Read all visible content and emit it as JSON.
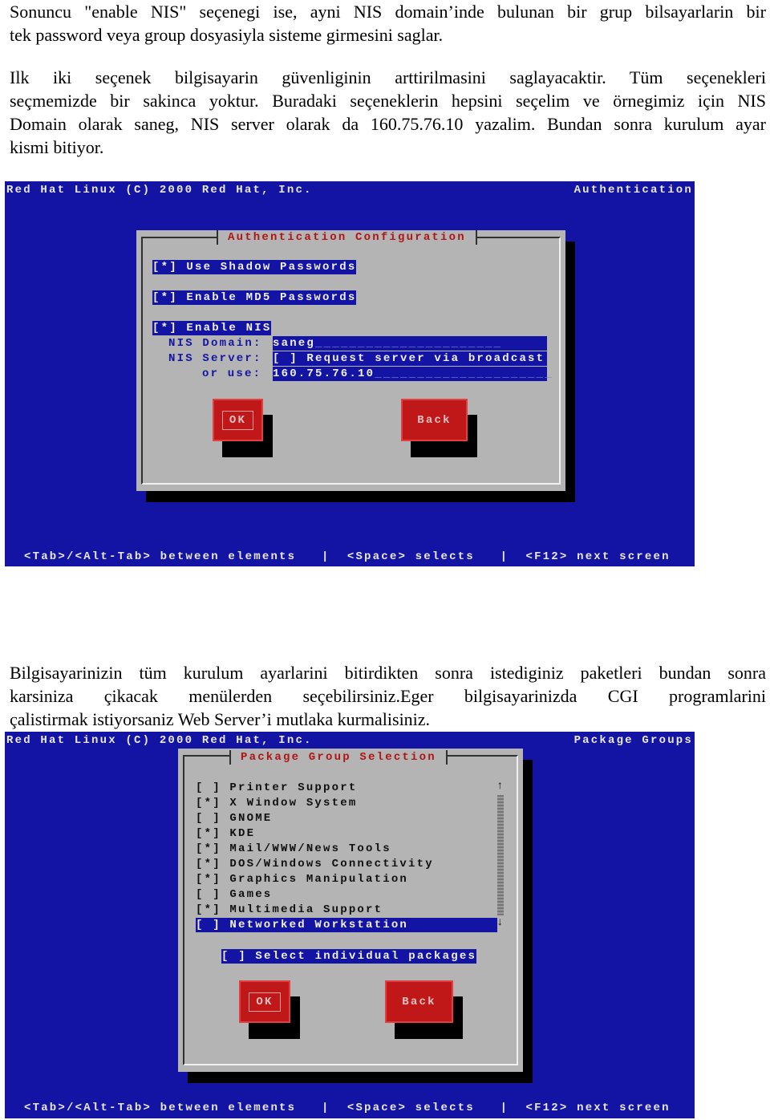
{
  "paragraphs": [
    [
      "Sonuncu \"enable NIS\" seçenegi ise, ayni NIS domain’inde bulunan bir grup bilsayarlarin bir",
      "tek password veya group dosyasiyla sisteme girmesini saglar."
    ],
    [
      "Ilk iki seçenek bilgisayarin güvenliginin arttirilmasini saglayacaktir. Tüm seçenekleri",
      "seçmemizde bir sakinca yoktur. Buradaki seçeneklerin hepsini seçelim ve örnegimiz için NIS",
      "Domain olarak saneg, NIS server olarak da 160.75.76.10 yazalim. Bundan sonra kurulum ayar",
      "kismi bitiyor."
    ],
    [
      "Bilgisayarinizin tüm kurulum ayarlarini bitirdikten sonra istediginiz paketleri bundan sonra",
      "karsiniza çikacak menülerden seçebilirsiniz.Eger bilgisayarinizda CGI programlarini",
      "çalistirmak istiyorsaniz Web Server’i mutlaka kurmalisiniz."
    ]
  ],
  "screen1": {
    "header_left": "Red Hat Linux (C) 2000 Red Hat, Inc.",
    "header_right": "Authentication",
    "dialog_title": "Authentication Configuration",
    "options": [
      "[*] Use Shadow Passwords",
      "[*] Enable MD5 Passwords",
      "[*] Enable NIS"
    ],
    "nis_domain_label": "NIS Domain:",
    "nis_domain_value": "saneg",
    "nis_server_label": "NIS Server:",
    "broadcast_option": "[ ] Request server via broadcast",
    "or_use_label": "or use:",
    "server_value": "160.75.76.10",
    "ok_label": "OK",
    "back_label": "Back",
    "footer": "<Tab>/<Alt-Tab> between elements   |  <Space> selects   |  <F12> next screen"
  },
  "screen2": {
    "header_left": "Red Hat Linux (C) 2000 Red Hat, Inc.",
    "header_right": "Package Groups",
    "dialog_title": "Package Group Selection",
    "packages": [
      {
        "check": "[ ]",
        "name": "Printer Support"
      },
      {
        "check": "[*]",
        "name": "X Window System"
      },
      {
        "check": "[ ]",
        "name": "GNOME"
      },
      {
        "check": "[*]",
        "name": "KDE"
      },
      {
        "check": "[*]",
        "name": "Mail/WWW/News Tools"
      },
      {
        "check": "[*]",
        "name": "DOS/Windows Connectivity"
      },
      {
        "check": "[*]",
        "name": "Graphics Manipulation"
      },
      {
        "check": "[ ]",
        "name": "Games"
      },
      {
        "check": "[*]",
        "name": "Multimedia Support"
      },
      {
        "check": "[ ]",
        "name": "Networked Workstation"
      }
    ],
    "selected_index": 9,
    "individual_option": "[ ] Select individual packages",
    "ok_label": "OK",
    "back_label": "Back",
    "footer": "<Tab>/<Alt-Tab> between elements   |  <Space> selects   |  <F12> next screen"
  },
  "colors": {
    "screen_bg": "#1414a4",
    "dialog_bg": "#b4b4b4",
    "title_red": "#b01414",
    "button_red": "#c01818"
  }
}
